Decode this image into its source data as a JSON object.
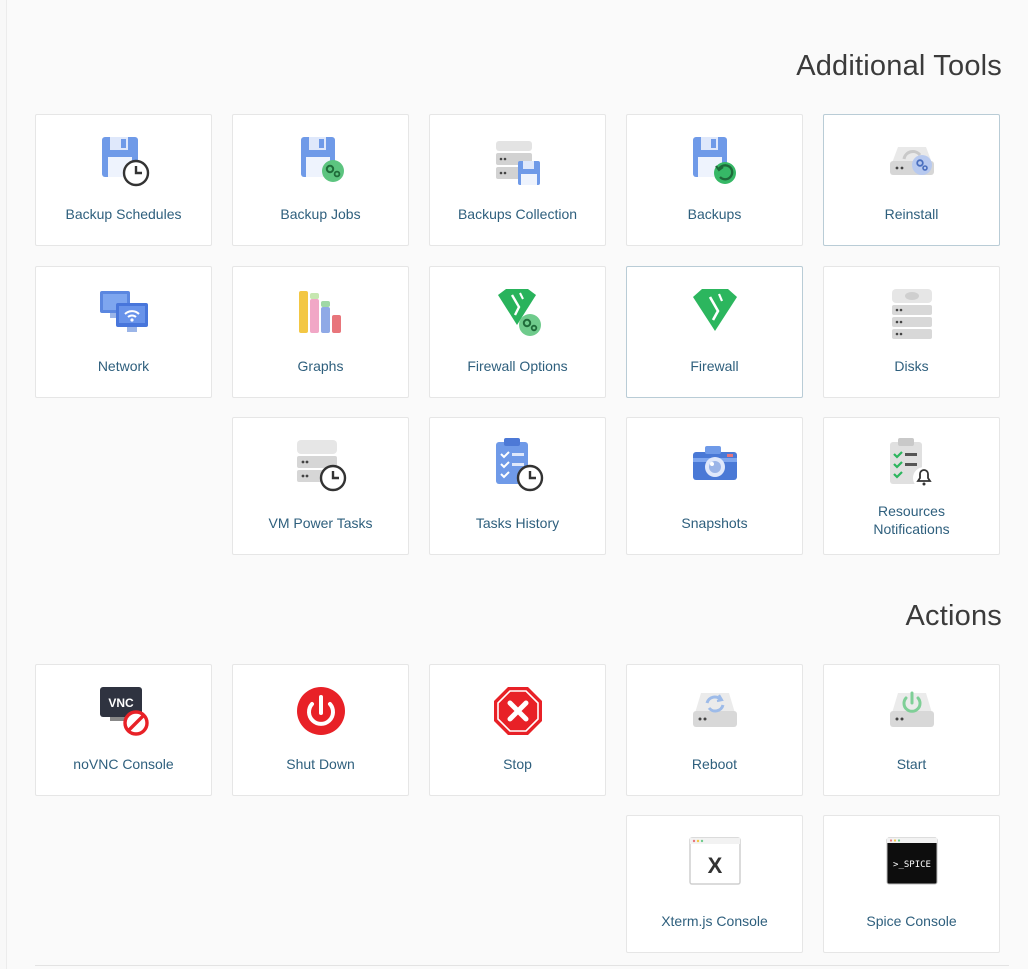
{
  "sections": {
    "tools_title": "Additional Tools",
    "actions_title": "Actions"
  },
  "tools": [
    {
      "label": "Backup Schedules",
      "icon": "floppy-clock-icon"
    },
    {
      "label": "Backup Jobs",
      "icon": "floppy-gear-icon"
    },
    {
      "label": "Backups Collection",
      "icon": "server-floppy-icon"
    },
    {
      "label": "Backups",
      "icon": "floppy-restore-icon"
    },
    {
      "label": "Reinstall",
      "icon": "drive-gear-icon"
    },
    {
      "label": "Network",
      "icon": "network-monitors-icon"
    },
    {
      "label": "Graphs",
      "icon": "bar-graph-icon"
    },
    {
      "label": "Firewall Options",
      "icon": "firewall-gear-icon"
    },
    {
      "label": "Firewall",
      "icon": "firewall-icon"
    },
    {
      "label": "Disks",
      "icon": "disks-icon"
    },
    {
      "label": "VM Power Tasks",
      "icon": "server-clock-icon"
    },
    {
      "label": "Tasks History",
      "icon": "clipboard-clock-icon"
    },
    {
      "label": "Snapshots",
      "icon": "camera-icon"
    },
    {
      "label": "Resources Notifications",
      "label_line1": "Resources",
      "label_line2": "Notifications",
      "icon": "clipboard-bell-icon"
    }
  ],
  "actions": [
    {
      "label": "noVNC Console",
      "icon": "vnc-disabled-icon",
      "badge": "VNC"
    },
    {
      "label": "Shut Down",
      "icon": "power-icon"
    },
    {
      "label": "Stop",
      "icon": "stop-icon"
    },
    {
      "label": "Reboot",
      "icon": "drive-reboot-icon"
    },
    {
      "label": "Start",
      "icon": "drive-power-icon"
    },
    {
      "label": "Xterm.js Console",
      "icon": "xterm-icon",
      "badge": "X"
    },
    {
      "label": "Spice Console",
      "icon": "spice-console-icon",
      "badge": ">_SPICE"
    }
  ],
  "colors": {
    "label": "#2e5f7d",
    "floppy": "#6f9ae8",
    "green": "#3fbf6a",
    "red": "#e82127",
    "highlight_border": "#b9ccd6"
  }
}
